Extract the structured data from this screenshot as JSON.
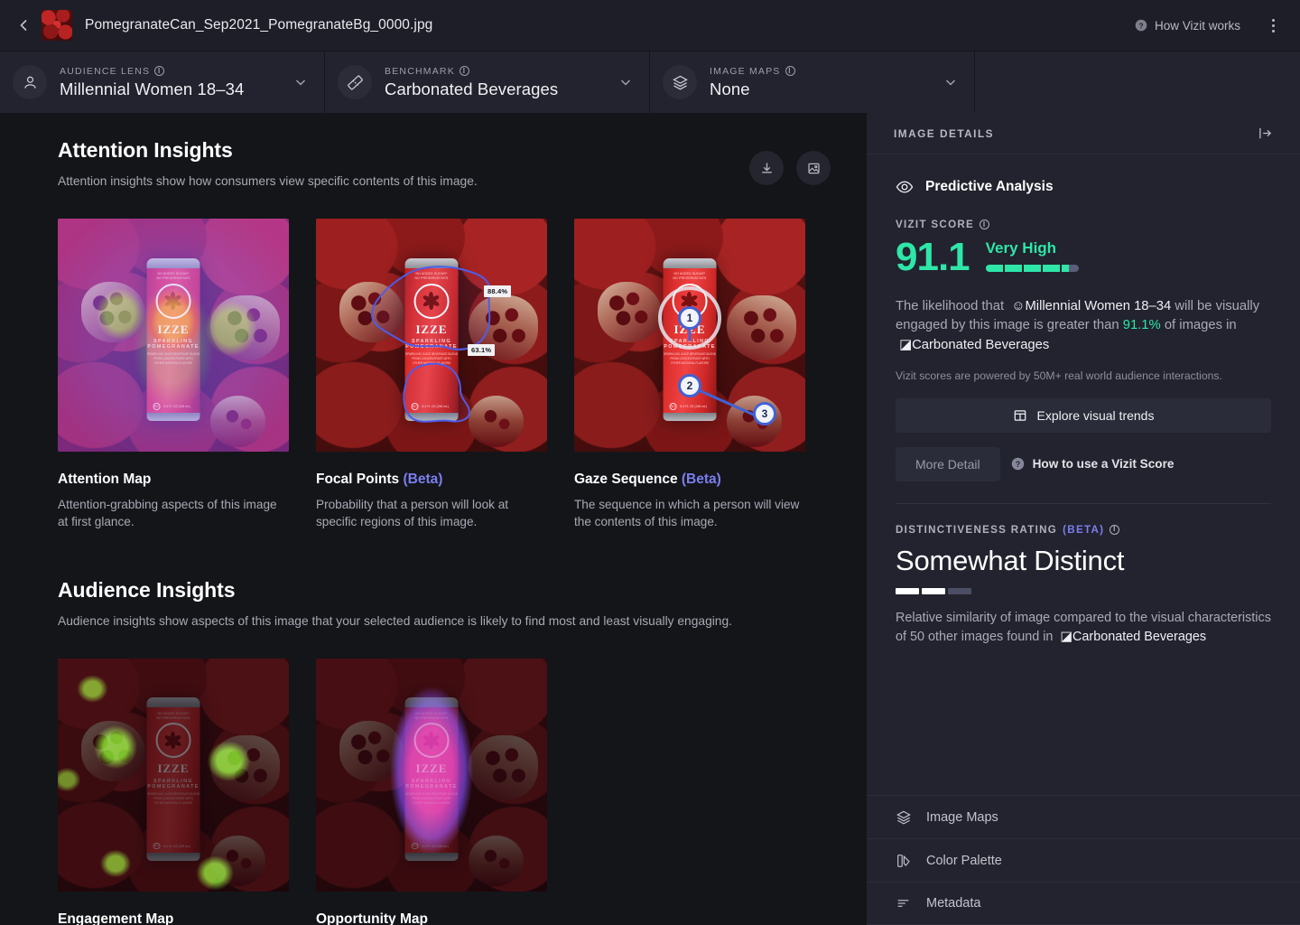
{
  "topbar": {
    "back_icon": "chevron-left-icon",
    "thumbnail_icon": "image-thumbnail",
    "file_name": "PomegranateCan_Sep2021_PomegranateBg_0000.jpg",
    "how_vizit_works": "How Vizit works",
    "help_icon": "question-circle-icon",
    "menu_icon": "kebab-menu-icon"
  },
  "selectors": [
    {
      "label": "AUDIENCE LENS",
      "value": "Millennial Women 18–34",
      "icon": "person-icon",
      "chevron": "chevron-down-icon"
    },
    {
      "label": "BENCHMARK",
      "value": "Carbonated Beverages",
      "icon": "ruler-icon",
      "chevron": "chevron-down-icon"
    },
    {
      "label": "IMAGE MAPS",
      "value": "None",
      "icon": "layers-icon",
      "chevron": "chevron-down-icon"
    }
  ],
  "attention": {
    "title": "Attention Insights",
    "subtitle": "Attention insights show how consumers view specific contents of this image.",
    "download_icon": "download-icon",
    "image_icon": "image-icon",
    "cards": [
      {
        "title": "Attention Map",
        "beta": "",
        "desc": "Attention-grabbing aspects of this image at first glance."
      },
      {
        "title": "Focal Points",
        "beta": "(Beta)",
        "desc": "Probability that a person will look at specific regions of this image.",
        "focal_values": [
          "88.4%",
          "63.1%"
        ]
      },
      {
        "title": "Gaze Sequence",
        "beta": "(Beta)",
        "desc": "The sequence in which a person will view the contents of this image.",
        "gaze_order": [
          "1",
          "2",
          "3"
        ]
      }
    ]
  },
  "audience": {
    "title": "Audience Insights",
    "subtitle": "Audience insights show aspects of this image that your selected audience is likely to find most and least visually engaging.",
    "cards": [
      {
        "title": "Engagement Map"
      },
      {
        "title": "Opportunity Map"
      }
    ]
  },
  "sidebar": {
    "header": "IMAGE DETAILS",
    "collapse_icon": "panel-collapse-icon",
    "predictive_analysis": "Predictive Analysis",
    "eye_icon": "eye-icon",
    "vizit_score_label": "VIZIT SCORE",
    "vizit_score_value": "91.1",
    "vizit_score_rating": "Very High",
    "desc_part1": "The likelihood that",
    "desc_audience": "Millennial Women 18–34",
    "desc_part2": "will be visually engaged by this image is greater than",
    "desc_percent": "91.1%",
    "desc_part3": "of images in",
    "desc_benchmark": "Carbonated Beverages",
    "note": "Vizit scores are powered by 50M+ real world audience interactions.",
    "explore_button": "Explore visual trends",
    "explore_icon": "layout-icon",
    "more_detail_button": "More Detail",
    "how_to_use_link": "How to use a Vizit Score",
    "how_to_use_icon": "question-circle-icon",
    "distinctiveness_label": "DISTINCTIVENESS RATING",
    "distinctiveness_beta": "(BETA)",
    "distinctiveness_value": "Somewhat Distinct",
    "distinctiveness_desc1": "Relative similarity of image compared to the visual characteristics of 50 other images found in",
    "distinctiveness_benchmark": "Carbonated Beverages",
    "footer_items": [
      {
        "label": "Image Maps",
        "icon": "layers-icon"
      },
      {
        "label": "Color Palette",
        "icon": "palette-icon"
      },
      {
        "label": "Metadata",
        "icon": "list-icon"
      }
    ]
  },
  "colors": {
    "accent_green": "#2ee6a8",
    "accent_purple": "#7b7ef0",
    "sidebar_bg": "#22232e",
    "main_bg": "#141519",
    "topbar_bg": "#1d1e27"
  }
}
